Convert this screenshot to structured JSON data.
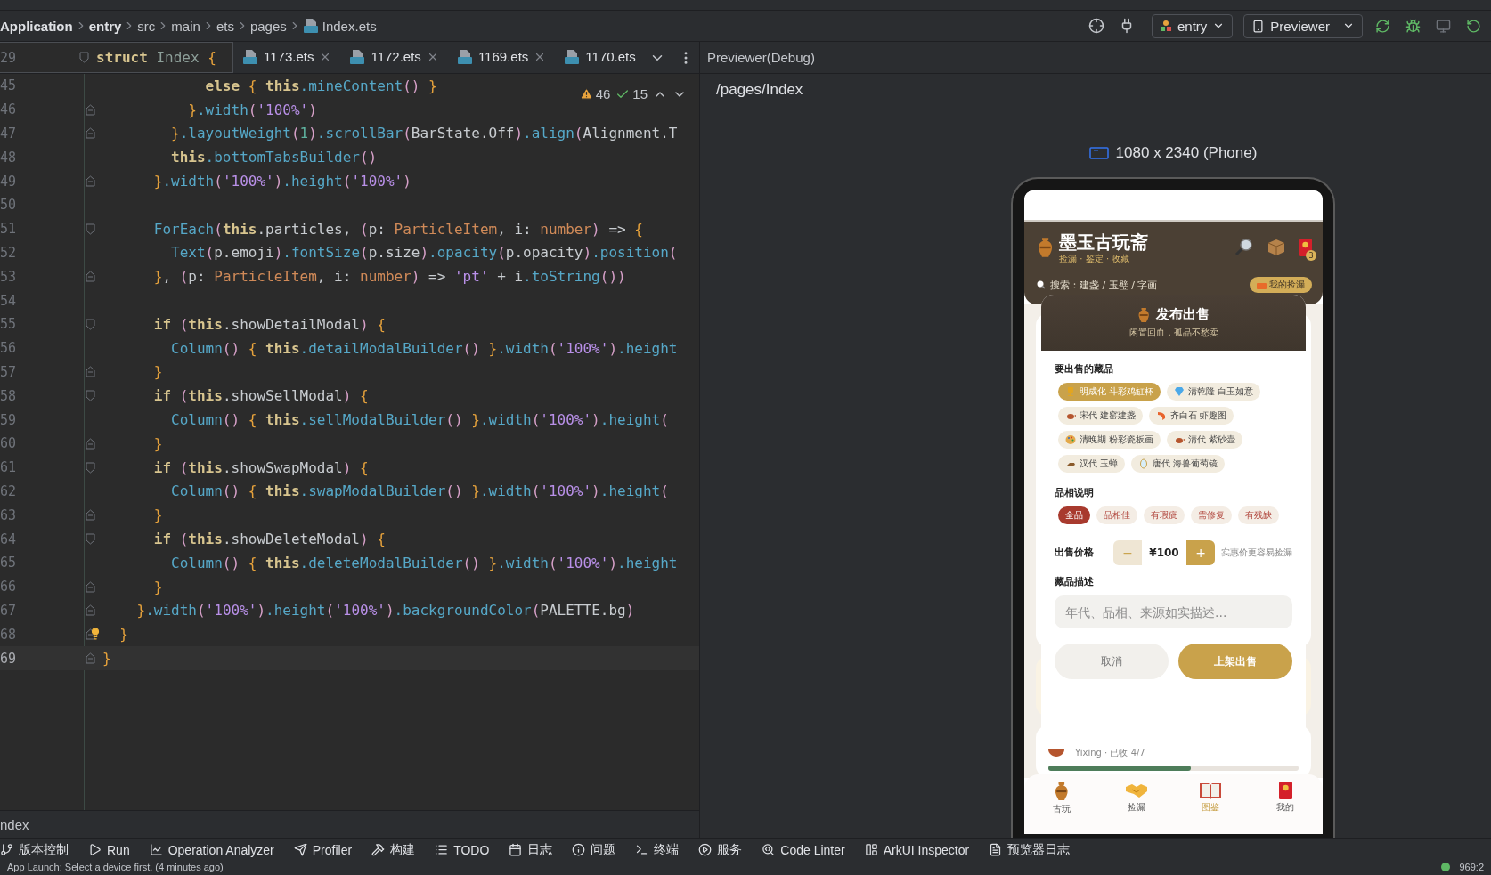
{
  "breadcrumb": [
    {
      "label": "Application",
      "kind": "module"
    },
    {
      "label": "entry",
      "kind": "module"
    },
    {
      "label": "src",
      "kind": "folder"
    },
    {
      "label": "main",
      "kind": "folder"
    },
    {
      "label": "ets",
      "kind": "folder"
    },
    {
      "label": "pages",
      "kind": "folder"
    },
    {
      "label": "Index.ets",
      "kind": "file"
    }
  ],
  "run_config": {
    "module": "entry",
    "device": "Previewer"
  },
  "sticky_line": {
    "number": "29",
    "code": [
      {
        "kind": "kw",
        "text": "struct"
      },
      {
        "kind": "cls",
        "text": " Index "
      },
      {
        "kind": "br",
        "text": "{"
      }
    ]
  },
  "tabs": [
    {
      "label": "1173.ets",
      "selected": false
    },
    {
      "label": "1172.ets",
      "selected": false
    },
    {
      "label": "1169.ets",
      "selected": false
    },
    {
      "label": "1170.ets",
      "selected": false
    }
  ],
  "editor": {
    "warnings": "46",
    "checks": "15",
    "lines": [
      {
        "n": "45",
        "kind": "plain",
        "current": false,
        "hint": false,
        "code": [
          {
            "kind": "kw",
            "text": "            else "
          },
          {
            "kind": "br",
            "text": "{ "
          },
          {
            "kind": "kw",
            "text": "this"
          },
          {
            "kind": "fn",
            "text": ".mineContent"
          },
          {
            "kind": "pa",
            "text": "() "
          },
          {
            "kind": "br",
            "text": "}"
          }
        ]
      },
      {
        "n": "46",
        "kind": "fold_end",
        "current": false,
        "hint": false,
        "code": [
          {
            "kind": "br",
            "text": "          }"
          },
          {
            "kind": "fn",
            "text": ".width"
          },
          {
            "kind": "pa",
            "text": "("
          },
          {
            "kind": "str",
            "text": "'100%'"
          },
          {
            "kind": "pa",
            "text": ")"
          }
        ]
      },
      {
        "n": "47",
        "kind": "fold_end",
        "current": false,
        "hint": false,
        "code": [
          {
            "kind": "br",
            "text": "        }"
          },
          {
            "kind": "fn",
            "text": ".layoutWeight"
          },
          {
            "kind": "pa",
            "text": "("
          },
          {
            "kind": "num",
            "text": "1"
          },
          {
            "kind": "pa",
            "text": ")"
          },
          {
            "kind": "fn",
            "text": ".scrollBar"
          },
          {
            "kind": "pa",
            "text": "("
          },
          {
            "kind": "p",
            "text": "BarState.Off"
          },
          {
            "kind": "pa",
            "text": ")"
          },
          {
            "kind": "fn",
            "text": ".align"
          },
          {
            "kind": "pa",
            "text": "("
          },
          {
            "kind": "p",
            "text": "Alignment.T"
          }
        ]
      },
      {
        "n": "48",
        "kind": "plain",
        "current": false,
        "hint": false,
        "code": [
          {
            "kind": "kw",
            "text": "        this"
          },
          {
            "kind": "fn",
            "text": ".bottomTabsBuilder"
          },
          {
            "kind": "pa",
            "text": "()"
          }
        ]
      },
      {
        "n": "49",
        "kind": "fold_end",
        "current": false,
        "hint": false,
        "code": [
          {
            "kind": "br",
            "text": "      }"
          },
          {
            "kind": "fn",
            "text": ".width"
          },
          {
            "kind": "pa",
            "text": "("
          },
          {
            "kind": "str",
            "text": "'100%'"
          },
          {
            "kind": "pa",
            "text": ")"
          },
          {
            "kind": "fn",
            "text": ".height"
          },
          {
            "kind": "pa",
            "text": "("
          },
          {
            "kind": "str",
            "text": "'100%'"
          },
          {
            "kind": "pa",
            "text": ")"
          }
        ]
      },
      {
        "n": "50",
        "kind": "plain",
        "current": false,
        "hint": false
      },
      {
        "n": "51",
        "kind": "fold_start",
        "current": false,
        "hint": false,
        "code": [
          {
            "kind": "fn",
            "text": "      ForEach"
          },
          {
            "kind": "pa",
            "text": "("
          },
          {
            "kind": "kw",
            "text": "this"
          },
          {
            "kind": "p",
            "text": ".particles, "
          },
          {
            "kind": "pa",
            "text": "("
          },
          {
            "kind": "p",
            "text": "p: "
          },
          {
            "kind": "type",
            "text": "ParticleItem"
          },
          {
            "kind": "p",
            "text": ", i: "
          },
          {
            "kind": "type",
            "text": "number"
          },
          {
            "kind": "pa",
            "text": ")"
          },
          {
            "kind": "p",
            "text": " => "
          },
          {
            "kind": "br",
            "text": "{"
          }
        ]
      },
      {
        "n": "52",
        "kind": "plain",
        "current": false,
        "hint": false,
        "code": [
          {
            "kind": "fn",
            "text": "        Text"
          },
          {
            "kind": "pa",
            "text": "("
          },
          {
            "kind": "p",
            "text": "p.emoji"
          },
          {
            "kind": "pa",
            "text": ")"
          },
          {
            "kind": "fn",
            "text": ".fontSize"
          },
          {
            "kind": "pa",
            "text": "("
          },
          {
            "kind": "p",
            "text": "p.size"
          },
          {
            "kind": "pa",
            "text": ")"
          },
          {
            "kind": "fn",
            "text": ".opacity"
          },
          {
            "kind": "pa",
            "text": "("
          },
          {
            "kind": "p",
            "text": "p.opacity"
          },
          {
            "kind": "pa",
            "text": ")"
          },
          {
            "kind": "fn",
            "text": ".position"
          },
          {
            "kind": "pa",
            "text": "("
          }
        ]
      },
      {
        "n": "53",
        "kind": "fold_end",
        "current": false,
        "hint": false,
        "code": [
          {
            "kind": "br",
            "text": "      }"
          },
          {
            "kind": "p",
            "text": ", "
          },
          {
            "kind": "pa",
            "text": "("
          },
          {
            "kind": "p",
            "text": "p: "
          },
          {
            "kind": "type",
            "text": "ParticleItem"
          },
          {
            "kind": "p",
            "text": ", i: "
          },
          {
            "kind": "type",
            "text": "number"
          },
          {
            "kind": "pa",
            "text": ")"
          },
          {
            "kind": "p",
            "text": " => "
          },
          {
            "kind": "str",
            "text": "'pt'"
          },
          {
            "kind": "p",
            "text": " + i"
          },
          {
            "kind": "fn",
            "text": ".toString"
          },
          {
            "kind": "pa",
            "text": "())"
          }
        ]
      },
      {
        "n": "54",
        "kind": "plain",
        "current": false,
        "hint": false
      },
      {
        "n": "55",
        "kind": "fold_start",
        "current": false,
        "hint": false,
        "code": [
          {
            "kind": "kw",
            "text": "      if "
          },
          {
            "kind": "pa",
            "text": "("
          },
          {
            "kind": "kw",
            "text": "this"
          },
          {
            "kind": "p",
            "text": ".showDetailModal"
          },
          {
            "kind": "pa",
            "text": ") "
          },
          {
            "kind": "br",
            "text": "{"
          }
        ]
      },
      {
        "n": "56",
        "kind": "plain",
        "current": false,
        "hint": false,
        "code": [
          {
            "kind": "fn",
            "text": "        Column"
          },
          {
            "kind": "pa",
            "text": "() "
          },
          {
            "kind": "br",
            "text": "{ "
          },
          {
            "kind": "kw",
            "text": "this"
          },
          {
            "kind": "fn",
            "text": ".detailModalBuilder"
          },
          {
            "kind": "pa",
            "text": "() "
          },
          {
            "kind": "br",
            "text": "}"
          },
          {
            "kind": "fn",
            "text": ".width"
          },
          {
            "kind": "pa",
            "text": "("
          },
          {
            "kind": "str",
            "text": "'100%'"
          },
          {
            "kind": "pa",
            "text": ")"
          },
          {
            "kind": "fn",
            "text": ".height"
          }
        ]
      },
      {
        "n": "57",
        "kind": "fold_end",
        "current": false,
        "hint": false,
        "code": [
          {
            "kind": "br",
            "text": "      }"
          }
        ]
      },
      {
        "n": "58",
        "kind": "fold_start",
        "current": false,
        "hint": false,
        "code": [
          {
            "kind": "kw",
            "text": "      if "
          },
          {
            "kind": "pa",
            "text": "("
          },
          {
            "kind": "kw",
            "text": "this"
          },
          {
            "kind": "p",
            "text": ".showSellModal"
          },
          {
            "kind": "pa",
            "text": ") "
          },
          {
            "kind": "br",
            "text": "{"
          }
        ]
      },
      {
        "n": "59",
        "kind": "plain",
        "current": false,
        "hint": false,
        "code": [
          {
            "kind": "fn",
            "text": "        Column"
          },
          {
            "kind": "pa",
            "text": "() "
          },
          {
            "kind": "br",
            "text": "{ "
          },
          {
            "kind": "kw",
            "text": "this"
          },
          {
            "kind": "fn",
            "text": ".sellModalBuilder"
          },
          {
            "kind": "pa",
            "text": "() "
          },
          {
            "kind": "br",
            "text": "}"
          },
          {
            "kind": "fn",
            "text": ".width"
          },
          {
            "kind": "pa",
            "text": "("
          },
          {
            "kind": "str",
            "text": "'100%'"
          },
          {
            "kind": "pa",
            "text": ")"
          },
          {
            "kind": "fn",
            "text": ".height"
          },
          {
            "kind": "pa",
            "text": "("
          }
        ]
      },
      {
        "n": "60",
        "kind": "fold_end",
        "current": false,
        "hint": false,
        "code": [
          {
            "kind": "br",
            "text": "      }"
          }
        ]
      },
      {
        "n": "61",
        "kind": "fold_start",
        "current": false,
        "hint": false,
        "code": [
          {
            "kind": "kw",
            "text": "      if "
          },
          {
            "kind": "pa",
            "text": "("
          },
          {
            "kind": "kw",
            "text": "this"
          },
          {
            "kind": "p",
            "text": ".showSwapModal"
          },
          {
            "kind": "pa",
            "text": ") "
          },
          {
            "kind": "br",
            "text": "{"
          }
        ]
      },
      {
        "n": "62",
        "kind": "plain",
        "current": false,
        "hint": false,
        "code": [
          {
            "kind": "fn",
            "text": "        Column"
          },
          {
            "kind": "pa",
            "text": "() "
          },
          {
            "kind": "br",
            "text": "{ "
          },
          {
            "kind": "kw",
            "text": "this"
          },
          {
            "kind": "fn",
            "text": ".swapModalBuilder"
          },
          {
            "kind": "pa",
            "text": "() "
          },
          {
            "kind": "br",
            "text": "}"
          },
          {
            "kind": "fn",
            "text": ".width"
          },
          {
            "kind": "pa",
            "text": "("
          },
          {
            "kind": "str",
            "text": "'100%'"
          },
          {
            "kind": "pa",
            "text": ")"
          },
          {
            "kind": "fn",
            "text": ".height"
          },
          {
            "kind": "pa",
            "text": "("
          }
        ]
      },
      {
        "n": "63",
        "kind": "fold_end",
        "current": false,
        "hint": false,
        "code": [
          {
            "kind": "br",
            "text": "      }"
          }
        ]
      },
      {
        "n": "64",
        "kind": "fold_start",
        "current": false,
        "hint": false,
        "code": [
          {
            "kind": "kw",
            "text": "      if "
          },
          {
            "kind": "pa",
            "text": "("
          },
          {
            "kind": "kw",
            "text": "this"
          },
          {
            "kind": "p",
            "text": ".showDeleteModal"
          },
          {
            "kind": "pa",
            "text": ") "
          },
          {
            "kind": "br",
            "text": "{"
          }
        ]
      },
      {
        "n": "65",
        "kind": "plain",
        "current": false,
        "hint": false,
        "code": [
          {
            "kind": "fn",
            "text": "        Column"
          },
          {
            "kind": "pa",
            "text": "() "
          },
          {
            "kind": "br",
            "text": "{ "
          },
          {
            "kind": "kw",
            "text": "this"
          },
          {
            "kind": "fn",
            "text": ".deleteModalBuilder"
          },
          {
            "kind": "pa",
            "text": "() "
          },
          {
            "kind": "br",
            "text": "}"
          },
          {
            "kind": "fn",
            "text": ".width"
          },
          {
            "kind": "pa",
            "text": "("
          },
          {
            "kind": "str",
            "text": "'100%'"
          },
          {
            "kind": "pa",
            "text": ")"
          },
          {
            "kind": "fn",
            "text": ".height"
          }
        ]
      },
      {
        "n": "66",
        "kind": "fold_end",
        "current": false,
        "hint": false,
        "code": [
          {
            "kind": "br",
            "text": "      }"
          }
        ]
      },
      {
        "n": "67",
        "kind": "fold_end",
        "current": false,
        "hint": false,
        "code": [
          {
            "kind": "br",
            "text": "    }"
          },
          {
            "kind": "fn",
            "text": ".width"
          },
          {
            "kind": "pa",
            "text": "("
          },
          {
            "kind": "str",
            "text": "'100%'"
          },
          {
            "kind": "pa",
            "text": ")"
          },
          {
            "kind": "fn",
            "text": ".height"
          },
          {
            "kind": "pa",
            "text": "("
          },
          {
            "kind": "str",
            "text": "'100%'"
          },
          {
            "kind": "pa",
            "text": ")"
          },
          {
            "kind": "fn",
            "text": ".backgroundColor"
          },
          {
            "kind": "pa",
            "text": "("
          },
          {
            "kind": "p",
            "text": "PALETTE.bg"
          },
          {
            "kind": "pa",
            "text": ")"
          }
        ]
      },
      {
        "n": "68",
        "kind": "fold_end",
        "current": false,
        "hint": true,
        "code": [
          {
            "kind": "br",
            "text": "  }"
          }
        ]
      },
      {
        "n": "69",
        "kind": "fold_end",
        "current": true,
        "hint": false,
        "code": [
          {
            "kind": "br",
            "text": "}"
          }
        ]
      }
    ]
  },
  "previewer": {
    "title": "Previewer(Debug)",
    "page": "/pages/Index",
    "device": "1080 x 2340 (Phone)",
    "app": {
      "title": "墨玉古玩斋",
      "tagline": "捡漏 · 鉴定 · 收藏",
      "badge": "3",
      "search": "搜索：建盏 / 玉璧 / 字画",
      "my_button": "我的捡漏",
      "background_item": {
        "caption": "Yixing · 已收 4/7",
        "level": 0.57
      },
      "nav": [
        {
          "label": "古玩",
          "selected": false
        },
        {
          "label": "捡漏",
          "selected": false
        },
        {
          "label": "图鉴",
          "selected": true
        },
        {
          "label": "我的",
          "selected": false
        }
      ],
      "modal": {
        "title": "发布出售",
        "subtitle": "闲置回血，孤品不愁卖",
        "items_label": "要出售的藏品",
        "items": [
          {
            "label": "明成化 斗彩鸡缸杯",
            "selected": true
          },
          {
            "label": "清乾隆 白玉如意",
            "selected": false
          },
          {
            "label": "宋代 建窑建盏",
            "selected": false
          },
          {
            "label": "齐白石 虾趣图",
            "selected": false
          },
          {
            "label": "清晚期 粉彩瓷板画",
            "selected": false
          },
          {
            "label": "清代 紫砂壶",
            "selected": false
          },
          {
            "label": "汉代 玉蝉",
            "selected": false
          },
          {
            "label": "唐代 海兽葡萄镜",
            "selected": false
          }
        ],
        "condition_label": "品相说明",
        "conditions": [
          {
            "label": "全品",
            "selected": true
          },
          {
            "label": "品相佳",
            "selected": false
          },
          {
            "label": "有瑕疵",
            "selected": false
          },
          {
            "label": "需修复",
            "selected": false
          },
          {
            "label": "有残缺",
            "selected": false
          }
        ],
        "price_label": "出售价格",
        "minus": "−",
        "price": "¥100",
        "plus": "+",
        "price_hint": "实惠价更容易捡漏",
        "description_label": "藏品描述",
        "description_placeholder": "年代、品相、来源如实描述...",
        "cancel": "取消",
        "submit": "上架出售"
      }
    }
  },
  "bottom_path": "ndex",
  "tool_windows": [
    "版本控制",
    "Run",
    "Operation Analyzer",
    "Profiler",
    "构建",
    "TODO",
    "日志",
    "问题",
    "终端",
    "服务",
    "Code Linter",
    "ArkUI Inspector",
    "预览器日志"
  ],
  "status": {
    "message": "App Launch: Select a device first. (4 minutes ago)",
    "position": "969:2"
  }
}
